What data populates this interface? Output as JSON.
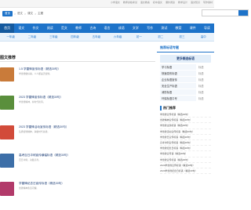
{
  "top_links": [
    "小学语文",
    "教师资格考试",
    "语文教案",
    "初中语文",
    "课外阅读",
    "教学设计",
    "语文知识",
    "写作素材"
  ],
  "breadcrumb": {
    "home": "首页",
    "items": [
      "语文",
      "课文",
      "主题"
    ],
    "sep": ">"
  },
  "nav": [
    "首页",
    "语文",
    "作文",
    "阅读",
    "范文",
    "教师",
    "古诗",
    "语言",
    "成语",
    "文学",
    "写作",
    "测试",
    "教案",
    "课件",
    "导读"
  ],
  "subnav": [
    "一年级",
    "二年级",
    "三年级",
    "四年级",
    "五年级",
    "六年级",
    "初一",
    "初二",
    "初三",
    "高中"
  ],
  "section_title": "图文推荐",
  "items": [
    {
      "title": "1.5 学雷锋宣传标语（精选30句）",
      "desc": "学雷锋做好事，人人都是活雷锋。"
    },
    {
      "title": "2023 学雷锋宣传标语（精选30句）",
      "desc": "学雷锋精神，树时代新风。"
    },
    {
      "title": "2023 学雷锋活动宣传标语（精选30句）",
      "desc": "弘扬雷锋精神，争做时代先锋。"
    },
    {
      "title": "高考百日冲刺宣传横幅标语（精选30句）",
      "desc": "百日冲刺，决胜高考。"
    },
    {
      "title": "学雷锋纪念日宣传标语（精选30句）",
      "desc": "雷锋精神永远闪耀。"
    }
  ],
  "sidebar": {
    "head": "推荐标语专题",
    "tag": "更多精选标语",
    "grid": [
      [
        "学习标语",
        "标语"
      ],
      [
        "快速发布标语",
        "标语"
      ],
      [
        "企业标语宣传",
        "标语"
      ],
      [
        "安全生产标语",
        "标语"
      ],
      [
        "消防标语",
        "标语"
      ],
      [
        "环保标语口号",
        "标语"
      ]
    ],
    "rec_title": "热门推荐",
    "rec_list": [
      "学雷锋宣传标语（精选30句）",
      "雷锋精神宣传标语（精选30句）",
      "学雷锋主题标语（精选30句）",
      "学雷锋活动宣传标语（精选30句）",
      "学雷锋日宣传标语（精选30句）",
      "高考冲刺宣传标语（精选30句）",
      "学雷锋纪念日标语（精选30句）",
      "学雷锋宣传语（精选30句）",
      "学雷锋宣传标语（精选30句）",
      "2023学雷锋宣传标语（精选30句）",
      "2023学雷锋纪念日标语（精选30句）"
    ]
  },
  "colors": {
    "accent": "#1e73c9",
    "thumbs": [
      "#c97b3a",
      "#5a8f3c",
      "#d24b3a",
      "#3d6fa8",
      "#b23a6a"
    ]
  }
}
